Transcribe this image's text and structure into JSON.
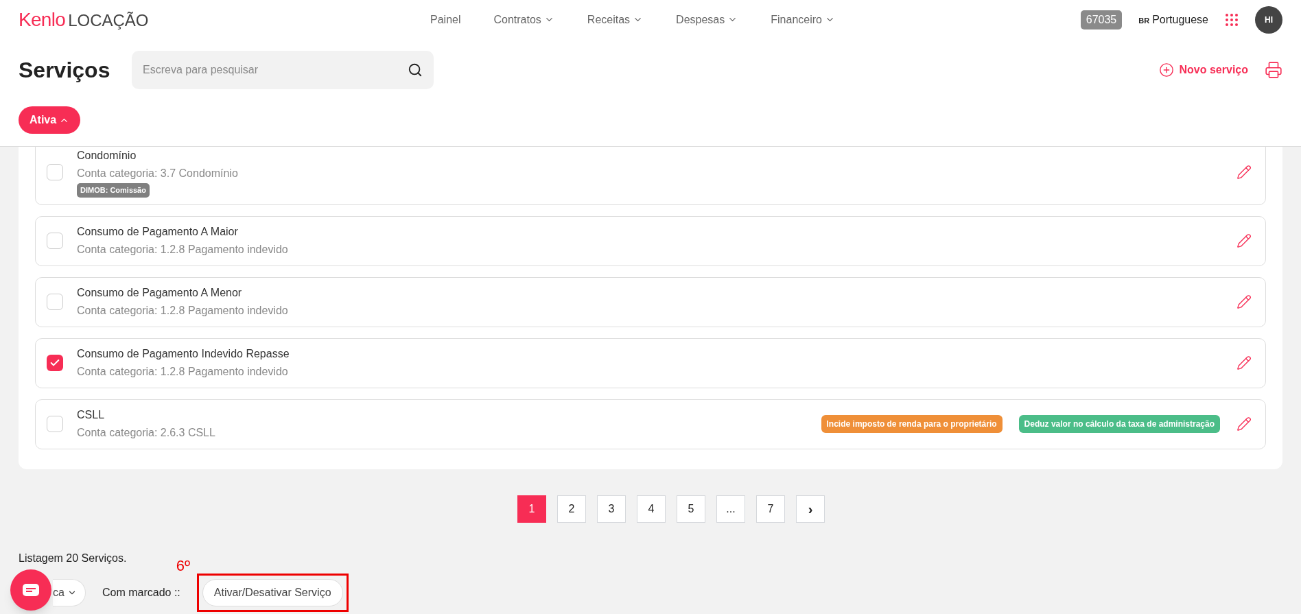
{
  "header": {
    "logo_brand": "Kenlo",
    "logo_product": "LOCAÇÃO",
    "nav": [
      {
        "label": "Painel",
        "dropdown": false
      },
      {
        "label": "Contratos",
        "dropdown": true
      },
      {
        "label": "Receitas",
        "dropdown": true
      },
      {
        "label": "Despesas",
        "dropdown": true
      },
      {
        "label": "Financeiro",
        "dropdown": true
      }
    ],
    "account_code": "67035",
    "language_code": "BR",
    "language": "Portuguese",
    "avatar": "HI"
  },
  "page": {
    "title": "Serviços",
    "search": {
      "placeholder": "Escreva para pesquisar"
    },
    "new_button": "Novo serviço",
    "filter_chip": "Ativa"
  },
  "services": [
    {
      "name": "Condomínio",
      "category": "Conta categoria: 3.7 Condomínio",
      "checked": false,
      "tags": [
        {
          "text": "DIMOB: Comissão",
          "color": "#808080"
        }
      ]
    },
    {
      "name": "Consumo de Pagamento A Maior",
      "category": "Conta categoria: 1.2.8 Pagamento indevido",
      "checked": false
    },
    {
      "name": "Consumo de Pagamento A Menor",
      "category": "Conta categoria: 1.2.8 Pagamento indevido",
      "checked": false
    },
    {
      "name": "Consumo de Pagamento Indevido Repasse",
      "category": "Conta categoria: 1.2.8 Pagamento indevido",
      "checked": true
    },
    {
      "name": "CSLL",
      "category": "Conta categoria: 2.6.3 CSLL",
      "checked": false,
      "side_tags": [
        {
          "text": "Incide imposto de renda para o proprietário",
          "color": "#ef8f38"
        },
        {
          "text": "Deduz valor no cálculo da taxa de administração",
          "color": "#4bbd88"
        }
      ]
    }
  ],
  "pagination": [
    {
      "label": "1",
      "selected": true
    },
    {
      "label": "2",
      "selected": false
    },
    {
      "label": "3",
      "selected": false
    },
    {
      "label": "4",
      "selected": false
    },
    {
      "label": "5",
      "selected": false
    },
    {
      "label": "...",
      "selected": false
    },
    {
      "label": "7",
      "selected": false
    }
  ],
  "pagination_next": "›",
  "footer": {
    "count": "Listagem 20 Serviços.",
    "bulk_select": "ca",
    "bulk_label": "Com marcado ::",
    "bulk_button": "Ativar/Desativar Serviço",
    "annotation": "6º"
  }
}
